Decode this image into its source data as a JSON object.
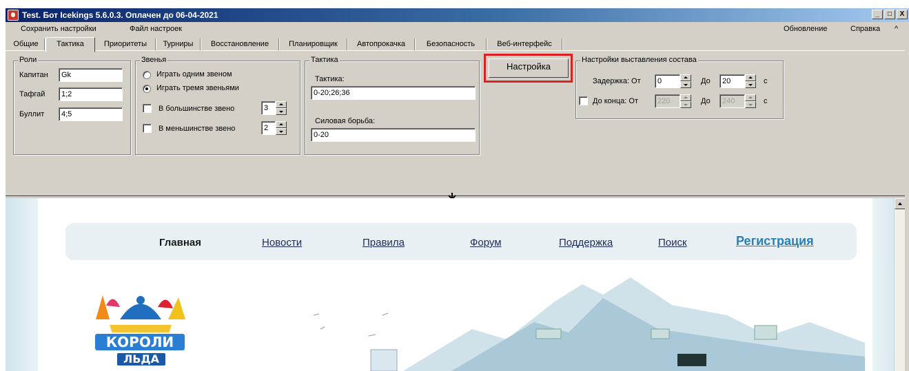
{
  "window": {
    "title": "Test. Бот Icekings 5.6.0.3. Оплачен до 06-04-2021",
    "buttons": {
      "minimize": "_",
      "maximize": "□",
      "close": "X"
    }
  },
  "menu": {
    "save_settings": "Сохранить настройки",
    "settings_file": "Файл настроек",
    "update": "Обновление",
    "help": "Справка",
    "collapse": "^"
  },
  "tabs": [
    {
      "label": "Общие"
    },
    {
      "label": "Тактика"
    },
    {
      "label": "Приоритеты"
    },
    {
      "label": "Турниры"
    },
    {
      "label": "Восстановление"
    },
    {
      "label": "Планировщик"
    },
    {
      "label": "Автопрокачка"
    },
    {
      "label": "Безопасность"
    },
    {
      "label": "Веб-интерфейс"
    }
  ],
  "roles": {
    "legend": "Роли",
    "captain_label": "Капитан",
    "captain_value": "Gk",
    "tafgai_label": "Тафгай",
    "tafgai_value": "1;2",
    "bullit_label": "Буллит",
    "bullit_value": "4;5"
  },
  "lines": {
    "legend": "Звенья",
    "one_line": "Играть одним звеном",
    "three_lines": "Играть тремя звеньями",
    "majority_label": "В большинстве звено",
    "majority_value": "3",
    "minority_label": "В меньшинстве звено",
    "minority_value": "2"
  },
  "tactics": {
    "legend": "Тактика",
    "tactic_label": "Тактика:",
    "tactic_value": "0-20;26;36",
    "power_label": "Силовая борьба:",
    "power_value": "0-20"
  },
  "setup_button": "Настройка",
  "lineup": {
    "legend": "Настройки выставления состава",
    "delay_label": "Задержка: От",
    "delay_from": "0",
    "to_label": "До",
    "delay_to": "20",
    "sec": "с",
    "until_end_label": "До конца: От",
    "end_from": "220",
    "end_to": "240"
  },
  "site": {
    "nav": {
      "home": "Главная",
      "news": "Новости",
      "rules": "Правила",
      "forum": "Форум",
      "support": "Поддержка",
      "search": "Поиск",
      "register": "Регистрация"
    },
    "logo_line1": "КОРОЛИ",
    "logo_line2": "ЛЬДА"
  },
  "colors": {
    "titlebar": "#0a246a",
    "highlight": "#e02020",
    "register_link": "#2b7fb8"
  }
}
